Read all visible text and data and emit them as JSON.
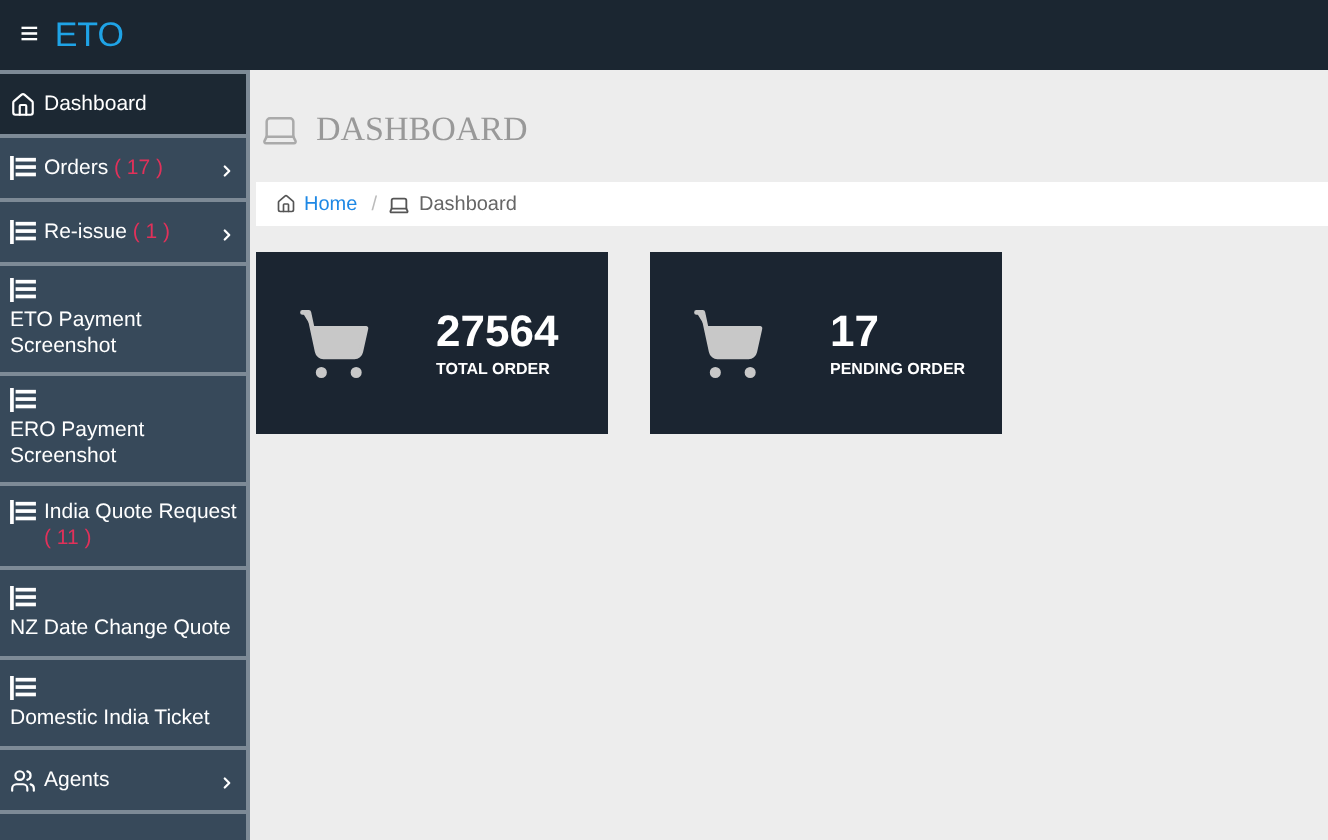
{
  "header": {
    "menu_glyph": "≡",
    "brand": "ETO"
  },
  "sidebar": {
    "items": [
      {
        "label": "Dashboard",
        "kind": "home",
        "selected": true,
        "has_arrow": false
      },
      {
        "label": "Orders",
        "count": "( 17 )",
        "kind": "list",
        "selected": false,
        "has_arrow": true
      },
      {
        "label": "Re-issue",
        "count": "( 1 )",
        "kind": "list",
        "selected": false,
        "has_arrow": true
      },
      {
        "label": "ETO Payment Screenshot",
        "kind": "list-stacked",
        "selected": false,
        "has_arrow": false
      },
      {
        "label": "ERO Payment Screenshot",
        "kind": "list-stacked",
        "selected": false,
        "has_arrow": false
      },
      {
        "label": "India Quote Request",
        "count": "( 11 )",
        "kind": "list",
        "selected": false,
        "has_arrow": false
      },
      {
        "label": "NZ Date Change Quote",
        "kind": "list-stacked",
        "selected": false,
        "has_arrow": false
      },
      {
        "label": "Domestic India Ticket",
        "kind": "list-stacked",
        "selected": false,
        "has_arrow": false
      },
      {
        "label": "Agents",
        "kind": "users",
        "selected": false,
        "has_arrow": true
      }
    ]
  },
  "page_title": "DASHBOARD",
  "breadcrumb": [
    {
      "label": "Home",
      "kind": "link"
    },
    {
      "separator": "/",
      "label": "Dashboard",
      "kind": "current"
    }
  ],
  "cards": [
    {
      "value": "27564",
      "label": "TOTAL ORDER"
    },
    {
      "value": "17",
      "label": "PENDING ORDER"
    }
  ]
}
